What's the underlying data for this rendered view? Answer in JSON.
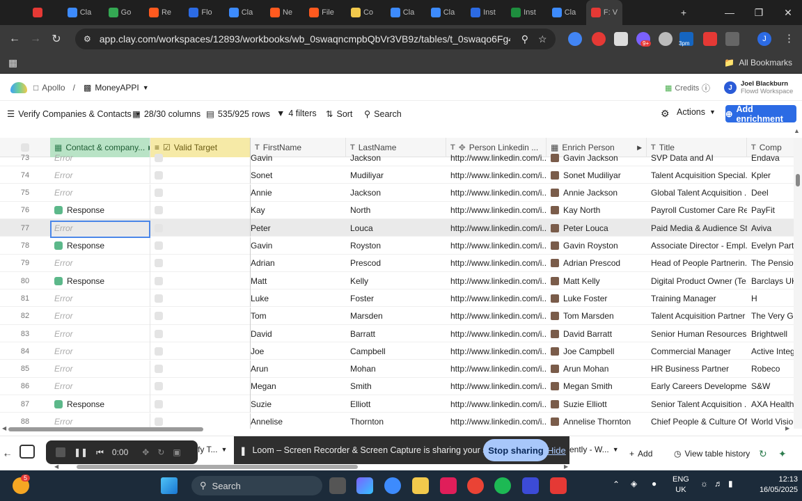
{
  "browser": {
    "tabs": [
      {
        "label": "",
        "color": "#e53935"
      },
      {
        "label": "Cla",
        "color": "#3d8bfd"
      },
      {
        "label": "Go",
        "color": "#34a853"
      },
      {
        "label": "Re",
        "color": "#ff5a1f"
      },
      {
        "label": "Flo",
        "color": "#2c6be4"
      },
      {
        "label": "Cla",
        "color": "#3d8bfd"
      },
      {
        "label": "Ne",
        "color": "#ff5a1f"
      },
      {
        "label": "File",
        "color": "#ff5a1f"
      },
      {
        "label": "Co",
        "color": "#f2c94c"
      },
      {
        "label": "Cla",
        "color": "#3d8bfd"
      },
      {
        "label": "Cla",
        "color": "#3d8bfd"
      },
      {
        "label": "Inst",
        "color": "#2c6be4"
      },
      {
        "label": "Inst",
        "color": "#1e8e3e"
      },
      {
        "label": "Cla",
        "color": "#3d8bfd"
      },
      {
        "label": "F: V",
        "color": "#e53935"
      }
    ],
    "url": "app.clay.com/workspaces/12893/workbooks/wb_0swaqncmpbQbVr3VB9z/tables/t_0swaqo6Fg45pVav4A...",
    "bookmarks_label": "All Bookmarks",
    "ext_badge": "9+",
    "ext_badge2": "3pm"
  },
  "app": {
    "breadcrumb": [
      "Apollo",
      "/",
      "MoneyAPPI"
    ],
    "credits_label": "Credits",
    "user_name": "Joel Blackburn",
    "user_workspace": "Flowd Workspace",
    "user_initial": "J"
  },
  "toolbar": {
    "view_name": "Verify Companies & Contacts",
    "columns": "28/30 columns",
    "rows": "535/925 rows",
    "filters": "4 filters",
    "sort": "Sort",
    "search": "Search",
    "actions": "Actions",
    "add_enrichment": "Add enrichment"
  },
  "columns": [
    {
      "key": "cc",
      "label": "Contact & company..."
    },
    {
      "key": "vt",
      "label": "Valid Target"
    },
    {
      "key": "fn",
      "label": "FirstName"
    },
    {
      "key": "ln",
      "label": "LastName"
    },
    {
      "key": "li",
      "label": "Person Linkedin ..."
    },
    {
      "key": "ep",
      "label": "Enrich Person"
    },
    {
      "key": "ti",
      "label": "Title"
    },
    {
      "key": "co",
      "label": "Comp"
    }
  ],
  "rows": [
    {
      "num": "73",
      "cc": "Error",
      "fn": "Gavin",
      "ln": "Jackson",
      "li": "http://www.linkedin.com/i...",
      "ep": "Gavin Jackson",
      "ti": "SVP Data and AI",
      "co": "Endava"
    },
    {
      "num": "74",
      "cc": "Error",
      "fn": "Sonet",
      "ln": "Mudiliyar",
      "li": "http://www.linkedin.com/i...",
      "ep": "Sonet Mudiliyar",
      "ti": "Talent Acquisition Special...",
      "co": "Kpler"
    },
    {
      "num": "75",
      "cc": "Error",
      "fn": "Annie",
      "ln": "Jackson",
      "li": "http://www.linkedin.com/i...",
      "ep": "Annie Jackson",
      "ti": "Global Talent Acquisition ...",
      "co": "Deel"
    },
    {
      "num": "76",
      "cc": "Response",
      "fn": "Kay",
      "ln": "North",
      "li": "http://www.linkedin.com/i...",
      "ep": "Kay North",
      "ti": "Payroll Customer Care Re...",
      "co": "PayFit"
    },
    {
      "num": "77",
      "cc": "Error",
      "fn": "Peter",
      "ln": "Louca",
      "li": "http://www.linkedin.com/i...",
      "ep": "Peter Louca",
      "ti": "Paid Media & Audience St...",
      "co": "Aviva"
    },
    {
      "num": "78",
      "cc": "Response",
      "fn": "Gavin",
      "ln": "Royston",
      "li": "http://www.linkedin.com/i...",
      "ep": "Gavin Royston",
      "ti": "Associate Director - Empl...",
      "co": "Evelyn Partn"
    },
    {
      "num": "79",
      "cc": "Error",
      "fn": "Adrian",
      "ln": "Prescod",
      "li": "http://www.linkedin.com/i...",
      "ep": "Adrian Prescod",
      "ti": "Head of People Partnerin...",
      "co": "The Pension"
    },
    {
      "num": "80",
      "cc": "Response",
      "fn": "Matt",
      "ln": "Kelly",
      "li": "http://www.linkedin.com/i...",
      "ep": "Matt Kelly",
      "ti": "Digital Product Owner (Te...",
      "co": "Barclays UK"
    },
    {
      "num": "81",
      "cc": "Error",
      "fn": "Luke",
      "ln": "Foster",
      "li": "http://www.linkedin.com/i...",
      "ep": "Luke Foster",
      "ti": "Training Manager",
      "co": "H"
    },
    {
      "num": "82",
      "cc": "Error",
      "fn": "Tom",
      "ln": "Marsden",
      "li": "http://www.linkedin.com/i...",
      "ep": "Tom Marsden",
      "ti": "Talent Acquisition Partner",
      "co": "The Very Gro"
    },
    {
      "num": "83",
      "cc": "Error",
      "fn": "David",
      "ln": "Barratt",
      "li": "http://www.linkedin.com/i...",
      "ep": "David Barratt",
      "ti": "Senior Human Resources...",
      "co": "Brightwell"
    },
    {
      "num": "84",
      "cc": "Error",
      "fn": "Joe",
      "ln": "Campbell",
      "li": "http://www.linkedin.com/i...",
      "ep": "Joe Campbell",
      "ti": "Commercial Manager",
      "co": "Active Integr"
    },
    {
      "num": "85",
      "cc": "Error",
      "fn": "Arun",
      "ln": "Mohan",
      "li": "http://www.linkedin.com/i...",
      "ep": "Arun Mohan",
      "ti": "HR Business Partner",
      "co": "Robeco"
    },
    {
      "num": "86",
      "cc": "Error",
      "fn": "Megan",
      "ln": "Smith",
      "li": "http://www.linkedin.com/i...",
      "ep": "Megan Smith",
      "ti": "Early Careers Developme...",
      "co": "S&W"
    },
    {
      "num": "87",
      "cc": "Response",
      "fn": "Suzie",
      "ln": "Elliott",
      "li": "http://www.linkedin.com/i...",
      "ep": "Suzie Elliott",
      "ti": "Senior Talent Acquisition ...",
      "co": "AXA Health"
    },
    {
      "num": "88",
      "cc": "Error",
      "fn": "Annelise",
      "ln": "Thornton",
      "li": "http://www.linkedin.com/i...",
      "ep": "Annelise Thornton",
      "ti": "Chief People & Culture Of...",
      "co": "World Vision"
    }
  ],
  "bottom": {
    "timer": "0:00",
    "loom_message": "Loom – Screen Recorder & Screen Capture is sharing your screen.",
    "stop_sharing": "Stop sharing",
    "hide": "Hide",
    "add": "Add",
    "view_history": "View table history",
    "truncated_left": "fy T...",
    "truncated_mid": "ently - W..."
  },
  "taskbar": {
    "search_placeholder": "Search",
    "lang_top": "ENG",
    "lang_bottom": "UK",
    "time": "12:13",
    "date": "16/05/2025",
    "notif_count": "5"
  }
}
